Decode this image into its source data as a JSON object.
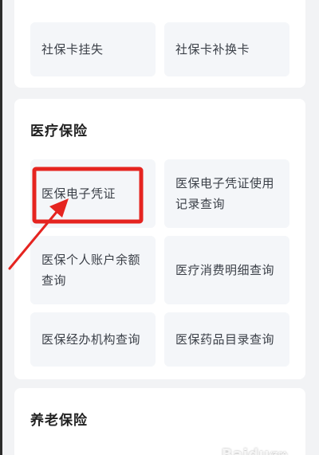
{
  "social": {
    "tiles": [
      {
        "label": "社保卡挂失"
      },
      {
        "label": "社保卡补换卡"
      }
    ]
  },
  "medical": {
    "title": "医疗保险",
    "tiles": [
      {
        "label": "医保电子凭证"
      },
      {
        "label": "医保电子凭证使用记录查询"
      },
      {
        "label": "医保个人账户余额查询"
      },
      {
        "label": "医疗消费明细查询"
      },
      {
        "label": "医保经办机构查询"
      },
      {
        "label": "医保药品目录查询"
      }
    ]
  },
  "pension": {
    "title": "养老保险"
  },
  "watermark": {
    "brand": "Baidu",
    "sub": "经验"
  },
  "colors": {
    "annotation_red": "#e52420",
    "tile_bg": "#f4f6f9",
    "page_bg": "#f2f3f5"
  }
}
